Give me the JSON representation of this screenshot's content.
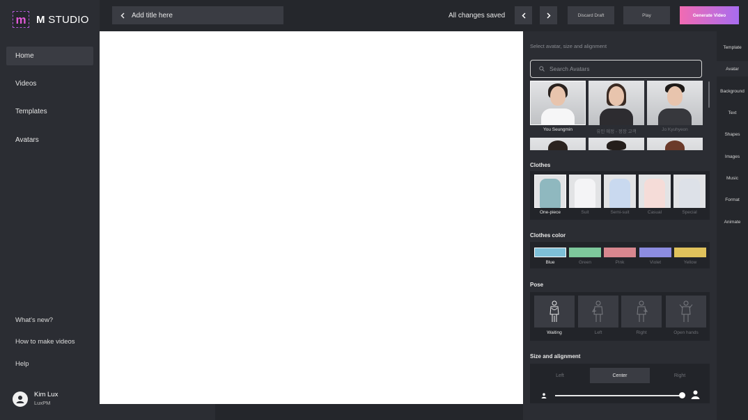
{
  "brand": {
    "mark": "m",
    "name_bold": "M",
    "name_rest": " STUDIO"
  },
  "nav": [
    {
      "label": "Home",
      "active": true
    },
    {
      "label": "Videos"
    },
    {
      "label": "Templates"
    },
    {
      "label": "Avatars"
    }
  ],
  "bottom_links": [
    "What's new?",
    "How to make videos",
    "Help"
  ],
  "user": {
    "name": "Kim Lux",
    "role": "LuxPM"
  },
  "topbar": {
    "title_placeholder": "Add title here",
    "status": "All changes saved",
    "discard_label": "Discard Draft",
    "play_label": "Play",
    "generate_label": "Generate Video"
  },
  "panel": {
    "subtitle": "Select avatar, size and alignment",
    "search_placeholder": "Search Avatars",
    "avatars": [
      {
        "name": "You Seungmin",
        "selected": true
      },
      {
        "name": "유민 예정 - 정장 고객"
      },
      {
        "name": "Jo Kyuhyeon"
      }
    ],
    "clothes_title": "Clothes",
    "clothes": [
      {
        "label": "One-piece",
        "selected": true,
        "color": "#8fb8bf"
      },
      {
        "label": "Suit",
        "color": "#f4f4f6"
      },
      {
        "label": "Semi-suit",
        "color": "#c9d9ef"
      },
      {
        "label": "Casual",
        "color": "#f5dcd8"
      },
      {
        "label": "Special",
        "color": "#dde1e8"
      }
    ],
    "color_title": "Clothes color",
    "colors": [
      {
        "label": "Blue",
        "hex": "#7ec0d8",
        "selected": true
      },
      {
        "label": "Green",
        "hex": "#7ec89c"
      },
      {
        "label": "Pink",
        "hex": "#d8878f"
      },
      {
        "label": "Violet",
        "hex": "#8c8ce0"
      },
      {
        "label": "Yellow",
        "hex": "#e0c25c"
      }
    ],
    "pose_title": "Pose",
    "poses": [
      {
        "label": "Waiting",
        "selected": true
      },
      {
        "label": "Left"
      },
      {
        "label": "Right"
      },
      {
        "label": "Open hands"
      }
    ],
    "size_title": "Size and alignment",
    "align_options": [
      {
        "label": "Left"
      },
      {
        "label": "Center",
        "active": true
      },
      {
        "label": "Right"
      }
    ],
    "size_level": 1.0
  },
  "tabs": [
    {
      "label": "Template"
    },
    {
      "label": "Avatar",
      "active": true
    },
    {
      "label": "Background"
    },
    {
      "label": "Text"
    },
    {
      "label": "Shapes"
    },
    {
      "label": "Images"
    },
    {
      "label": "Music"
    },
    {
      "label": "Format"
    },
    {
      "label": "Animate"
    }
  ]
}
